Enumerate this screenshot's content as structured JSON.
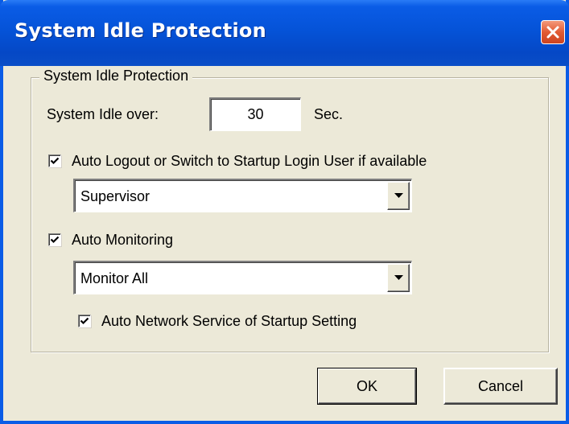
{
  "window": {
    "title": "System Idle Protection"
  },
  "group": {
    "legend": "System Idle Protection"
  },
  "idle": {
    "label": "System Idle over:",
    "value": "30",
    "unit": "Sec."
  },
  "auto_logout": {
    "checked": true,
    "label": "Auto Logout or Switch to Startup Login User if available",
    "select_value": "Supervisor"
  },
  "auto_monitoring": {
    "checked": true,
    "label": "Auto Monitoring",
    "select_value": "Monitor All"
  },
  "auto_network": {
    "checked": true,
    "label": "Auto Network Service of Startup Setting"
  },
  "buttons": {
    "ok": "OK",
    "cancel": "Cancel"
  },
  "icons": {
    "close": "close-icon",
    "check": "checkmark-icon",
    "dropdown": "dropdown-arrow-icon"
  }
}
